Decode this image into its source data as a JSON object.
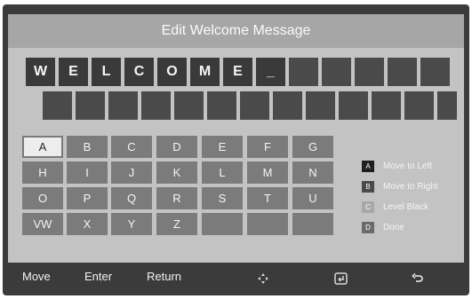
{
  "title": "Edit Welcome Message",
  "message_row1": [
    "W",
    "E",
    "L",
    "C",
    "O",
    "M",
    "E",
    "_",
    "",
    "",
    "",
    "",
    ""
  ],
  "message_row2": [
    "",
    "",
    "",
    "",
    "",
    "",
    "",
    "",
    "",
    "",
    "",
    "",
    ""
  ],
  "keyboard": {
    "rows": [
      [
        "A",
        "B",
        "C",
        "D",
        "E",
        "F",
        "G"
      ],
      [
        "H",
        "I",
        "J",
        "K",
        "L",
        "M",
        "N"
      ],
      [
        "O",
        "P",
        "Q",
        "R",
        "S",
        "T",
        "U"
      ],
      [
        "VW",
        "X",
        "Y",
        "Z",
        "",
        "",
        ""
      ]
    ],
    "selected": "A"
  },
  "legend": [
    {
      "badge": "A",
      "label": "Move to Left",
      "color": "#1f1f1f"
    },
    {
      "badge": "B",
      "label": "Move to Right",
      "color": "#4a4a4a"
    },
    {
      "badge": "C",
      "label": "Level Black",
      "color": "#a8a8a8"
    },
    {
      "badge": "D",
      "label": "Done",
      "color": "#6a6a6a"
    }
  ],
  "footer": {
    "move": "Move",
    "enter": "Enter",
    "return": "Return",
    "icons": [
      "move-arrows-icon",
      "enter-icon",
      "return-icon"
    ]
  }
}
